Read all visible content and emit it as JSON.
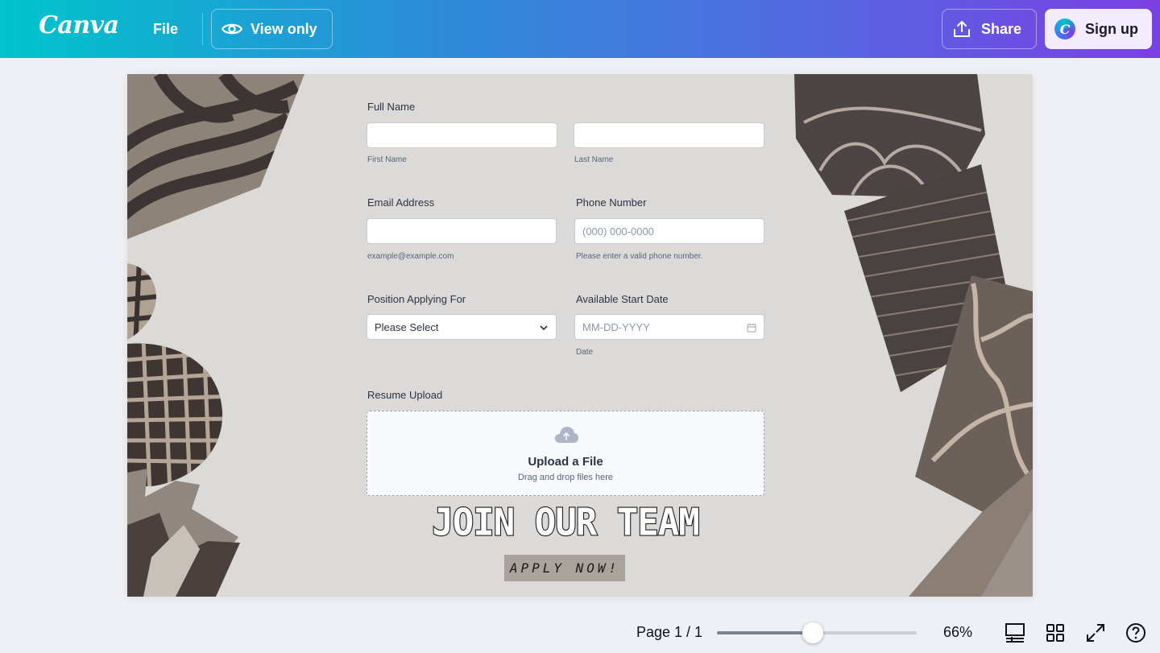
{
  "topbar": {
    "logo": "Canva",
    "file_label": "File",
    "view_only_label": "View only",
    "share_label": "Share",
    "signup_label": "Sign up",
    "signup_badge": "C"
  },
  "form": {
    "full_name": {
      "label": "Full Name",
      "first_sub": "First Name",
      "last_sub": "Last Name",
      "first_value": "",
      "last_value": ""
    },
    "email": {
      "label": "Email Address",
      "value": "",
      "sub": "example@example.com"
    },
    "phone": {
      "label": "Phone Number",
      "placeholder": "(000) 000-0000",
      "sub": "Please enter a valid phone number."
    },
    "position": {
      "label": "Position Applying For",
      "selected": "Please Select"
    },
    "start_date": {
      "label": "Available Start Date",
      "placeholder": "MM-DD-YYYY",
      "sub": "Date"
    },
    "resume": {
      "label": "Resume Upload",
      "title": "Upload a File",
      "sub": "Drag and drop files here"
    }
  },
  "design": {
    "headline": "JOIN OUR TEAM",
    "cta": "APPLY NOW!"
  },
  "bottombar": {
    "page_info": "Page 1 / 1",
    "zoom": "66%",
    "zoom_fraction": 0.48
  },
  "colors": {
    "brand_start": "#00c4cc",
    "brand_end": "#7b3fe4",
    "canvas_bg": "#dcdad8"
  }
}
